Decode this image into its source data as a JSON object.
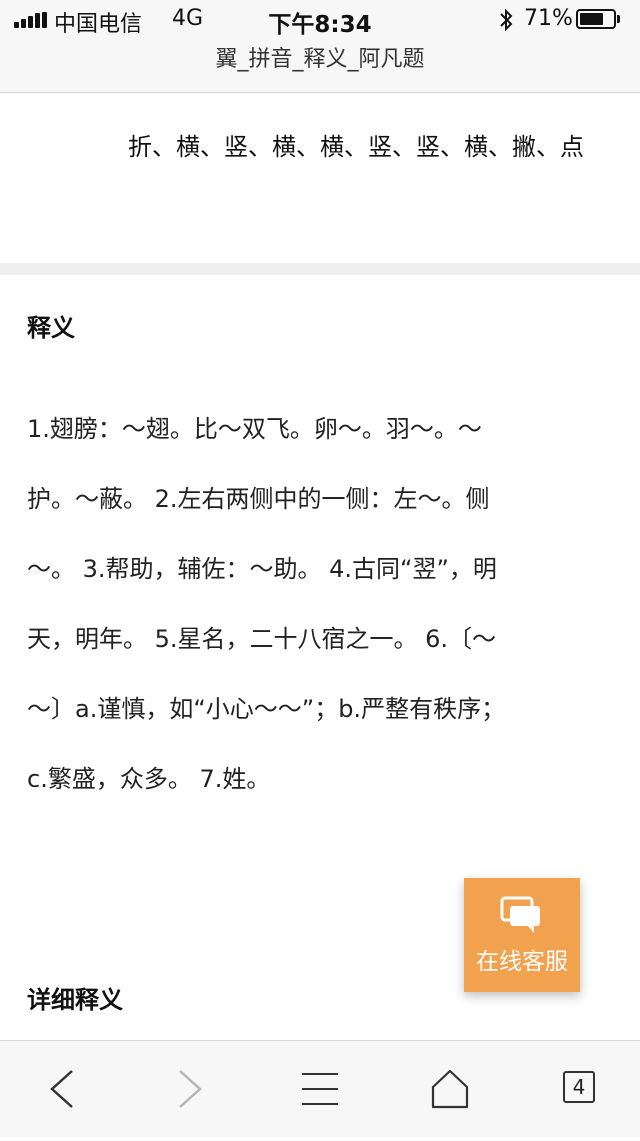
{
  "status_bar": {
    "carrier": "中国电信",
    "network": "4G",
    "time": "下午8:34",
    "battery_percent": "71%",
    "battery_level": 0.71
  },
  "browser": {
    "page_title": "翼_拼音_释义_阿凡题",
    "tab_count": "4"
  },
  "content": {
    "strokes": "折、横、竖、横、横、竖、竖、横、撇、点",
    "meaning_heading": "释义",
    "meaning_text": "1.翅膀：～翅。比～双飞。卵～。羽～。～护。～蔽。 2.左右两侧中的一侧：左～。侧～。 3.帮助，辅佐：～助。 4.古同“翌”，明天，明年。 5.星名，二十八宿之一。 6.〔～～〕a.谨慎，如“小心～～”；b.严整有秩序；c.繁盛，众多。 7.姓。",
    "detail_heading": "详细释义"
  },
  "service_button": {
    "label": "在线客服",
    "color": "#f2a14e"
  },
  "toolbar": {
    "icons": [
      "back-icon",
      "forward-icon",
      "menu-icon",
      "home-icon",
      "tabs-icon"
    ]
  }
}
